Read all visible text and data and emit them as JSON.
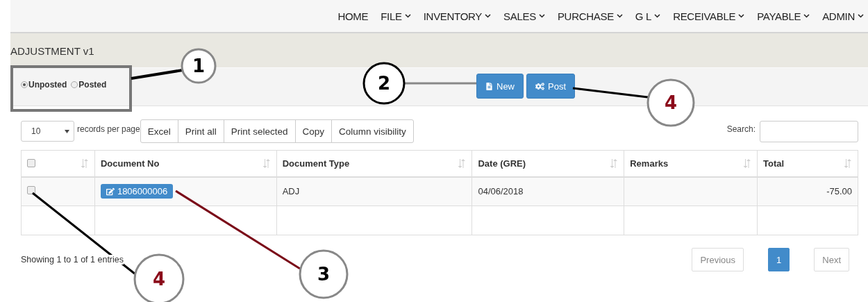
{
  "nav": [
    {
      "label": "HOME",
      "has_menu": false
    },
    {
      "label": "FILE",
      "has_menu": true
    },
    {
      "label": "INVENTORY",
      "has_menu": true
    },
    {
      "label": "SALES",
      "has_menu": true
    },
    {
      "label": "PURCHASE",
      "has_menu": true
    },
    {
      "label": "G L",
      "has_menu": true
    },
    {
      "label": "RECEIVABLE",
      "has_menu": true
    },
    {
      "label": "PAYABLE",
      "has_menu": true
    },
    {
      "label": "ADMIN",
      "has_menu": true
    }
  ],
  "page_title": "ADJUSTMENT v1",
  "filter": [
    {
      "label": "Unposted",
      "selected": true
    },
    {
      "label": "Posted",
      "selected": false
    }
  ],
  "actions": [
    {
      "label": "New",
      "kind": "new"
    },
    {
      "label": "Post",
      "kind": "post"
    }
  ],
  "page_length": {
    "value": "10",
    "label": "records per page"
  },
  "export_buttons": [
    "Excel",
    "Print all",
    "Print selected",
    "Copy",
    "Column visibility"
  ],
  "search": {
    "label": "Search:"
  },
  "table": {
    "select_all_checked": false,
    "columns": [
      "Document No",
      "Document Type",
      "Date (GRE)",
      "Remarks",
      "Total"
    ],
    "rows": [
      {
        "checked": false,
        "document_no": "1806000006",
        "document_type": "ADJ",
        "date": "04/06/2018",
        "total": "-75.00"
      }
    ]
  },
  "info": "Showing 1 to 1 of 1 entries",
  "pagination": {
    "previous": "Previous",
    "pages": [
      {
        "label": "1",
        "selected": true
      }
    ],
    "next": "Next"
  },
  "callouts": [
    {
      "label": "1",
      "color": "#000000"
    },
    {
      "label": "2",
      "color": "#000000"
    },
    {
      "label": "4",
      "color": "#8b0a1a"
    },
    {
      "label": "4",
      "color": "#8b0a1a"
    },
    {
      "label": "3",
      "color": "#000000"
    }
  ]
}
